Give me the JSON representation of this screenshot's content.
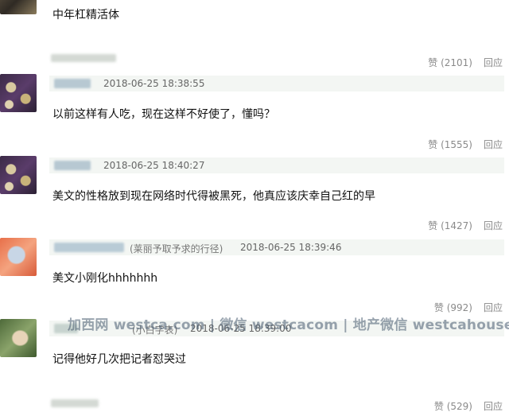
{
  "comments": [
    {
      "text": "中年杠精活体",
      "likes_label": "赞",
      "likes": "(2101)",
      "reply": "回应"
    },
    {
      "time": "2018-06-25 18:38:55",
      "text": "以前这样有人吃，现在这样不好使了，懂吗？",
      "likes_label": "赞",
      "likes": "(1555)",
      "reply": "回应"
    },
    {
      "time": "2018-06-25 18:40:27",
      "text": "美文的性格放到现在网络时代得被黑死，他真应该庆幸自己红的早",
      "likes_label": "赞",
      "likes": "(1427)",
      "reply": "回应"
    },
    {
      "source": "(莱丽予取予求的行径)",
      "time": "2018-06-25 18:39:46",
      "text": "美文小刚化hhhhhhh",
      "likes_label": "赞",
      "likes": "(992)",
      "reply": "回应"
    },
    {
      "source": "(小白字表)",
      "time": "2018-06-25 18:39:00",
      "text": "记得他好几次把记者怼哭过",
      "likes_label": "赞",
      "likes": "(529)",
      "reply": "回应"
    }
  ],
  "watermark": "加西网 westca.com | 微信 westcacom | 地产微信 westcahouse",
  "colors": {
    "meta_bar": "#f3f6f3",
    "muted_text": "#8a8a8a"
  }
}
